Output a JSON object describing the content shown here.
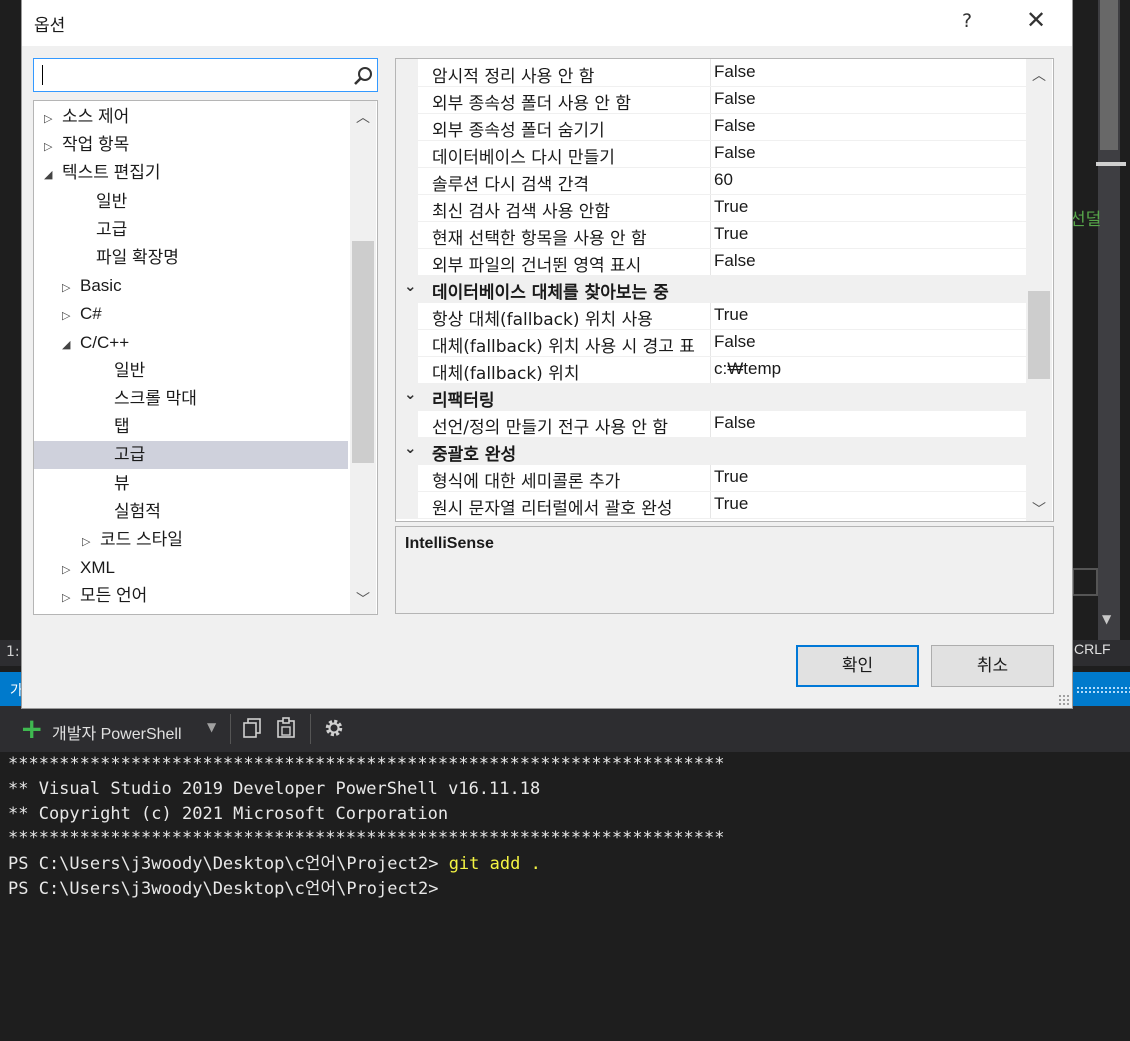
{
  "ide": {
    "side_text": "선덜",
    "status_left": "1:",
    "status_right": "CRLF",
    "tab_letter": "가"
  },
  "terminal": {
    "profile": "개발자 PowerShell",
    "lines": [
      "**********************************************************************",
      "** Visual Studio 2019 Developer PowerShell v16.11.18",
      "** Copyright (c) 2021 Microsoft Corporation",
      "**********************************************************************"
    ],
    "prompt": "PS C:\\Users\\j3woody\\Desktop\\c언어\\Project2> ",
    "command": "git add .",
    "prompt2": "PS C:\\Users\\j3woody\\Desktop\\c언어\\Project2>"
  },
  "dialog": {
    "title": "옵션",
    "help": "?",
    "close": "✕",
    "search": {
      "value": "",
      "placeholder": ""
    },
    "tree": [
      {
        "label": "소스 제어",
        "arrow": "▷"
      },
      {
        "label": "작업 항목",
        "arrow": "▷"
      },
      {
        "label": "텍스트 편집기",
        "arrow": "◢"
      },
      {
        "label": "일반",
        "arrow": ""
      },
      {
        "label": "고급",
        "arrow": ""
      },
      {
        "label": "파일 확장명",
        "arrow": ""
      },
      {
        "label": "Basic",
        "arrow": "▷"
      },
      {
        "label": "C#",
        "arrow": "▷"
      },
      {
        "label": "C/C++",
        "arrow": "◢"
      },
      {
        "label": "일반",
        "arrow": ""
      },
      {
        "label": "스크롤 막대",
        "arrow": ""
      },
      {
        "label": "탭",
        "arrow": ""
      },
      {
        "label": "고급",
        "arrow": ""
      },
      {
        "label": "뷰",
        "arrow": ""
      },
      {
        "label": "실험적",
        "arrow": ""
      },
      {
        "label": "코드 스타일",
        "arrow": "▷"
      },
      {
        "label": "XML",
        "arrow": "▷"
      },
      {
        "label": "모든 언어",
        "arrow": "▷"
      }
    ],
    "grid": [
      {
        "name": "암시적 정리 사용 안 함",
        "value": "False"
      },
      {
        "name": "외부 종속성 폴더 사용 안 함",
        "value": "False"
      },
      {
        "name": "외부 종속성 폴더 숨기기",
        "value": "False"
      },
      {
        "name": "데이터베이스 다시 만들기",
        "value": "False"
      },
      {
        "name": "솔루션 다시 검색 간격",
        "value": "60"
      },
      {
        "name": "최신 검사 검색 사용 안함",
        "value": "True"
      },
      {
        "name": "현재 선택한 항목을 사용 안 함",
        "value": "True"
      },
      {
        "name": "외부 파일의 건너뛴 영역 표시",
        "value": "False"
      },
      {
        "category": "데이터베이스 대체를 찾아보는 중"
      },
      {
        "name": "항상 대체(fallback) 위치 사용",
        "value": "True"
      },
      {
        "name": "대체(fallback) 위치 사용 시 경고 표",
        "value": "False"
      },
      {
        "name": "대체(fallback) 위치",
        "value": " c:₩temp"
      },
      {
        "category": "리팩터링"
      },
      {
        "name": "선언/정의 만들기 전구 사용 안 함",
        "value": "False"
      },
      {
        "category": "중괄호 완성"
      },
      {
        "name": "형식에 대한 세미콜론 추가",
        "value": "True"
      },
      {
        "name": "원시 문자열 리터럴에서 괄호 완성",
        "value": "True"
      }
    ],
    "description_title": "IntelliSense",
    "ok_label": "확인",
    "cancel_label": "취소"
  }
}
